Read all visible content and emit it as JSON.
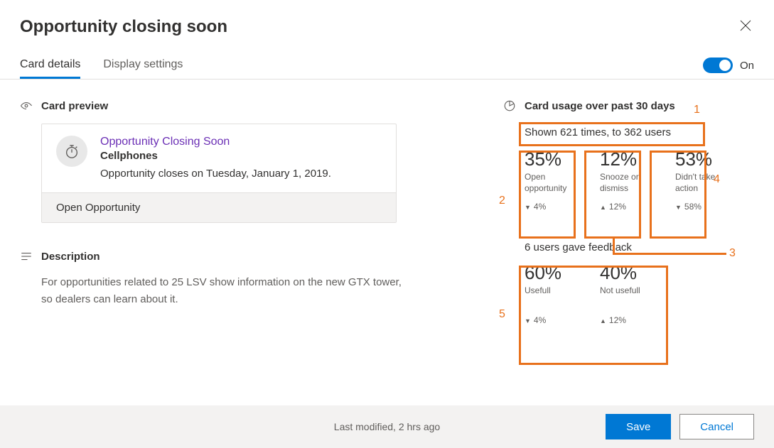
{
  "header": {
    "title": "Opportunity closing soon"
  },
  "tabs": {
    "card_details": "Card details",
    "display_settings": "Display settings"
  },
  "toggle": {
    "label": "On"
  },
  "preview": {
    "section_title": "Card preview",
    "card_title": "Opportunity Closing Soon",
    "card_subtitle": "Cellphones",
    "card_body": "Opportunity closes on Tuesday, January 1, 2019.",
    "action_label": "Open Opportunity"
  },
  "description": {
    "section_title": "Description",
    "text": "For opportunities related to 25 LSV show information on the new GTX tower, so dealers can learn about it."
  },
  "usage": {
    "section_title": "Card usage over past 30 days",
    "shown_text": "Shown 621 times, to 362 users",
    "stats": [
      {
        "pct": "35%",
        "label": "Open opportunity",
        "delta": "4%",
        "dir": "down"
      },
      {
        "pct": "12%",
        "label": "Snooze or dismiss",
        "delta": "12%",
        "dir": "up"
      },
      {
        "pct": "53%",
        "label": "Didn't take action",
        "delta": "58%",
        "dir": "down"
      }
    ],
    "feedback_heading": "6 users gave feedback",
    "feedback": [
      {
        "pct": "60%",
        "label": "Usefull",
        "delta": "4%",
        "dir": "down"
      },
      {
        "pct": "40%",
        "label": "Not usefull",
        "delta": "12%",
        "dir": "up"
      }
    ]
  },
  "annotations": {
    "n1": "1",
    "n2": "2",
    "n3": "3",
    "n4": "4",
    "n5": "5"
  },
  "footer": {
    "status": "Last modified, 2 hrs ago",
    "save": "Save",
    "cancel": "Cancel"
  }
}
